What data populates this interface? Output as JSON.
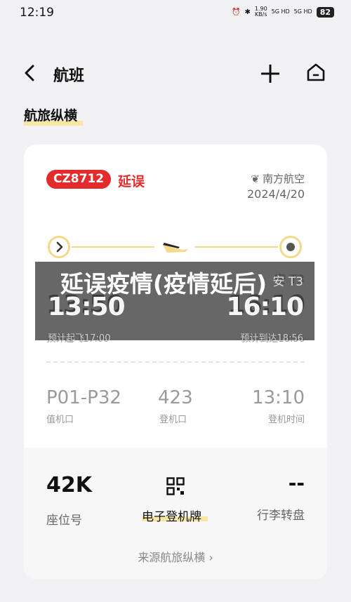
{
  "status_bar": {
    "time": "12:19",
    "net_speed": "1.90",
    "net_unit": "KB/s",
    "sig1": "5G HD",
    "sig2": "5G HD",
    "battery": "82"
  },
  "header": {
    "title": "航班"
  },
  "brand": "航旅纵横",
  "flight": {
    "number": "CZ8712",
    "status": "延误",
    "airline": "南方航空",
    "date": "2024/4/20",
    "departure": {
      "time": "13:50",
      "planned": "预计起飞17:00"
    },
    "arrival": {
      "terminal": "安 T3",
      "time": "16:10",
      "planned": "预计到达18:56"
    }
  },
  "stats": {
    "counter": {
      "value": "P01-P32",
      "label": "值机口"
    },
    "gate": {
      "value": "423",
      "label": "登机口"
    },
    "checkin_time": {
      "value": "13:10",
      "label": "登机时间"
    }
  },
  "bottom": {
    "seat_value": "42K",
    "seat_label": "座位号",
    "eboard_label": "电子登机牌",
    "belt_value": "--",
    "belt_label": "行李转盘",
    "source_link": "来源航旅纵横 ›"
  },
  "overlay": {
    "text": "延误疫情(疫情延后)"
  },
  "colors": {
    "accent_red": "#e32b2b",
    "route_gold": "#f3d98a",
    "highlight": "#f7e7a3"
  }
}
